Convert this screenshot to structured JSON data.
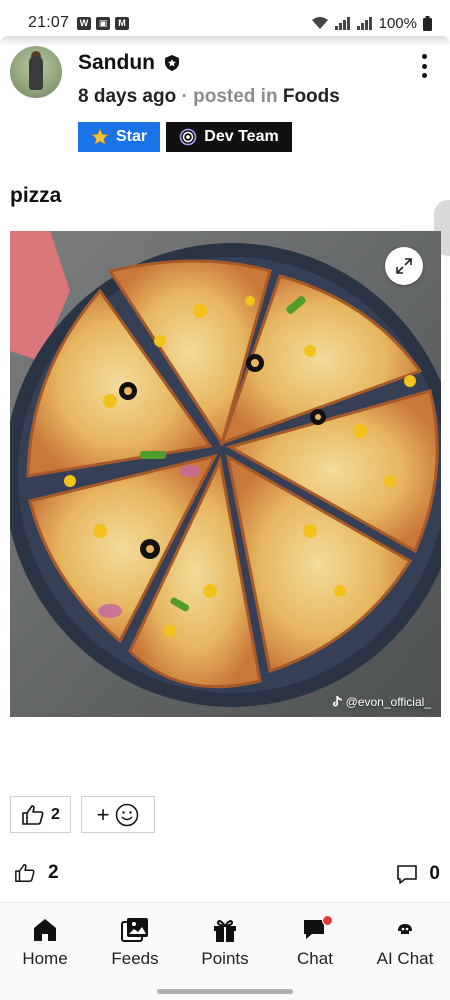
{
  "status_bar": {
    "time": "21:07",
    "battery": "100%"
  },
  "post": {
    "author": "Sandun",
    "age": "8 days ago",
    "posted_in_label": "· posted in",
    "category": "Foods",
    "tags": [
      {
        "label": "Star",
        "color": "#1a73e8",
        "icon": "star-icon"
      },
      {
        "label": "Dev Team",
        "color": "#111111",
        "icon": "spiral-icon"
      }
    ],
    "title": "pizza",
    "image_watermark": "@evon_official_"
  },
  "reactions": {
    "like_count": "2",
    "add_reaction_symbol": "+"
  },
  "stats": {
    "likes": "2",
    "comments": "0"
  },
  "bottom_nav": {
    "items": [
      {
        "label": "Home",
        "icon": "home-icon"
      },
      {
        "label": "Feeds",
        "icon": "feeds-icon"
      },
      {
        "label": "Points",
        "icon": "gift-icon"
      },
      {
        "label": "Chat",
        "icon": "chat-icon",
        "badge": true
      },
      {
        "label": "AI Chat",
        "icon": "ai-chat-icon"
      }
    ]
  },
  "colors": {
    "accent_blue": "#1a73e8",
    "badge_red": "#e53935"
  }
}
